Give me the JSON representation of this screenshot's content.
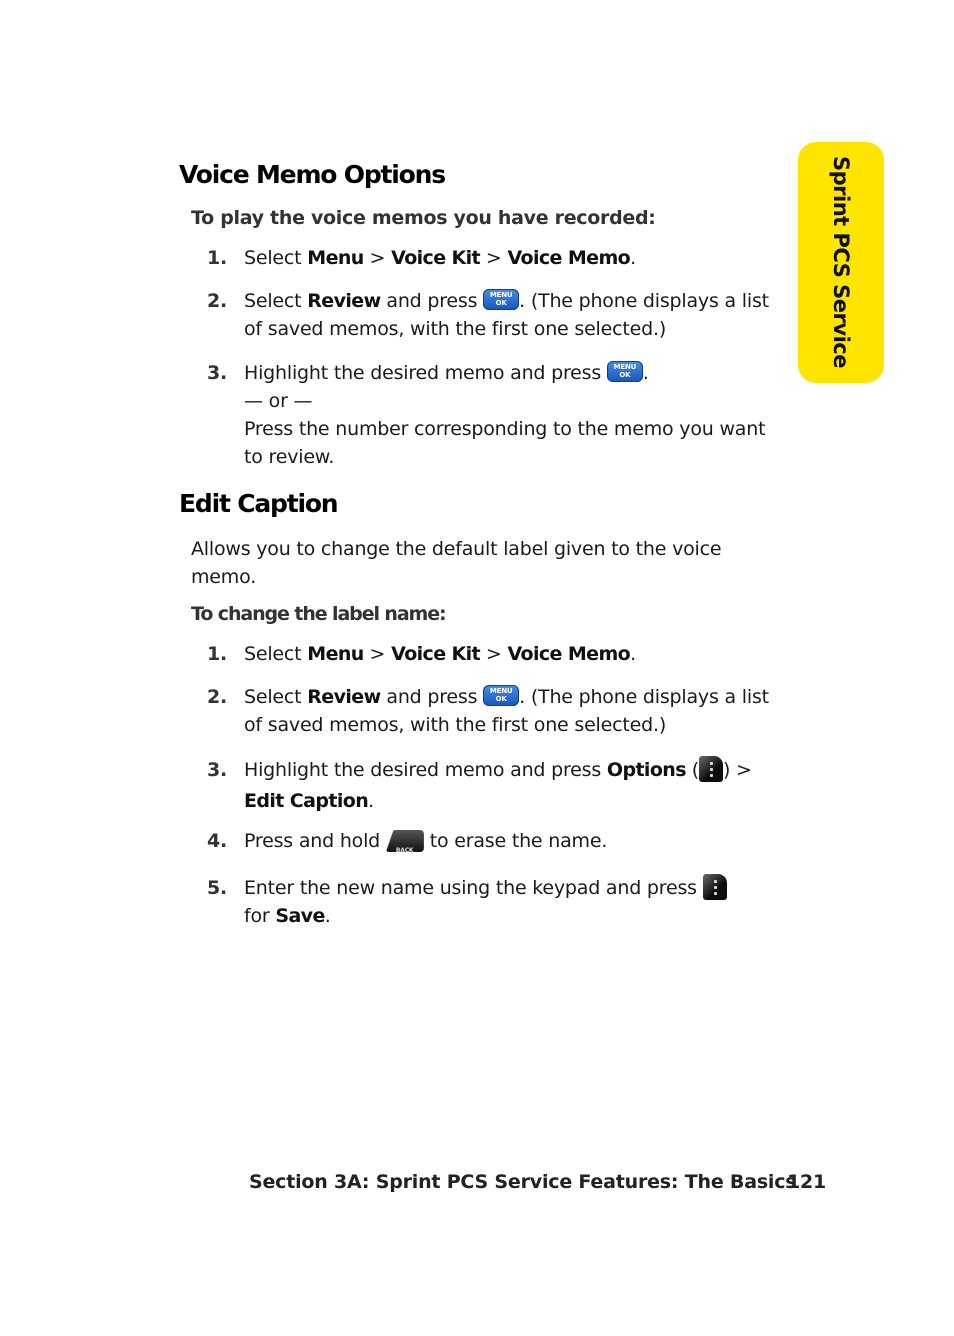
{
  "side_tab": {
    "label": "Sprint PCS Service",
    "color": "#ffe400"
  },
  "section1": {
    "heading": "Voice Memo Options",
    "intro": "To play the voice memos you have recorded:",
    "steps": [
      {
        "num": "1.",
        "pre": "Select ",
        "b1": "Menu",
        "s1": " > ",
        "b2": "Voice Kit",
        "s2": " > ",
        "b3": "Voice Memo",
        "end": "."
      },
      {
        "num": "2.",
        "pre": "Select ",
        "b1": "Review",
        "mid": " and press ",
        "key": "MENU/OK key",
        "post": ". (The phone displays a list of saved memos, with the first one selected.)"
      },
      {
        "num": "3.",
        "pre": "Highlight the desired memo and press ",
        "key": "MENU/OK key",
        "end": ".",
        "or": "— or —",
        "alt": "Press the number corresponding to the memo you want to review."
      }
    ]
  },
  "section2": {
    "heading": "Edit Caption",
    "description": "Allows you to change the default label given to the voice memo.",
    "intro": "To change the label name:",
    "steps": [
      {
        "num": "1.",
        "pre": "Select ",
        "b1": "Menu",
        "s1": " > ",
        "b2": "Voice Kit",
        "s2": " > ",
        "b3": "Voice Memo",
        "end": "."
      },
      {
        "num": "2.",
        "pre": "Select ",
        "b1": "Review",
        "mid": " and press ",
        "key": "MENU/OK key",
        "post": ". (The phone displays a list of saved memos, with the first one selected.)"
      },
      {
        "num": "3.",
        "pre": "Highlight the desired memo and press ",
        "b1": "Options",
        "paren_open": " (",
        "paren_close": ") > ",
        "b2": "Edit Caption",
        "end": "."
      },
      {
        "num": "4.",
        "pre": "Press and hold ",
        "post": " to erase the name."
      },
      {
        "num": "5.",
        "pre": "Enter the new name using the keypad and press ",
        "mid": " for ",
        "b1": "Save",
        "end": "."
      }
    ]
  },
  "keys": {
    "menu_top": "MENU",
    "menu_bottom": "OK",
    "back": "BACK"
  },
  "footer": {
    "section": "Section 3A: Sprint PCS Service Features: The Basics",
    "page_number": "121"
  }
}
